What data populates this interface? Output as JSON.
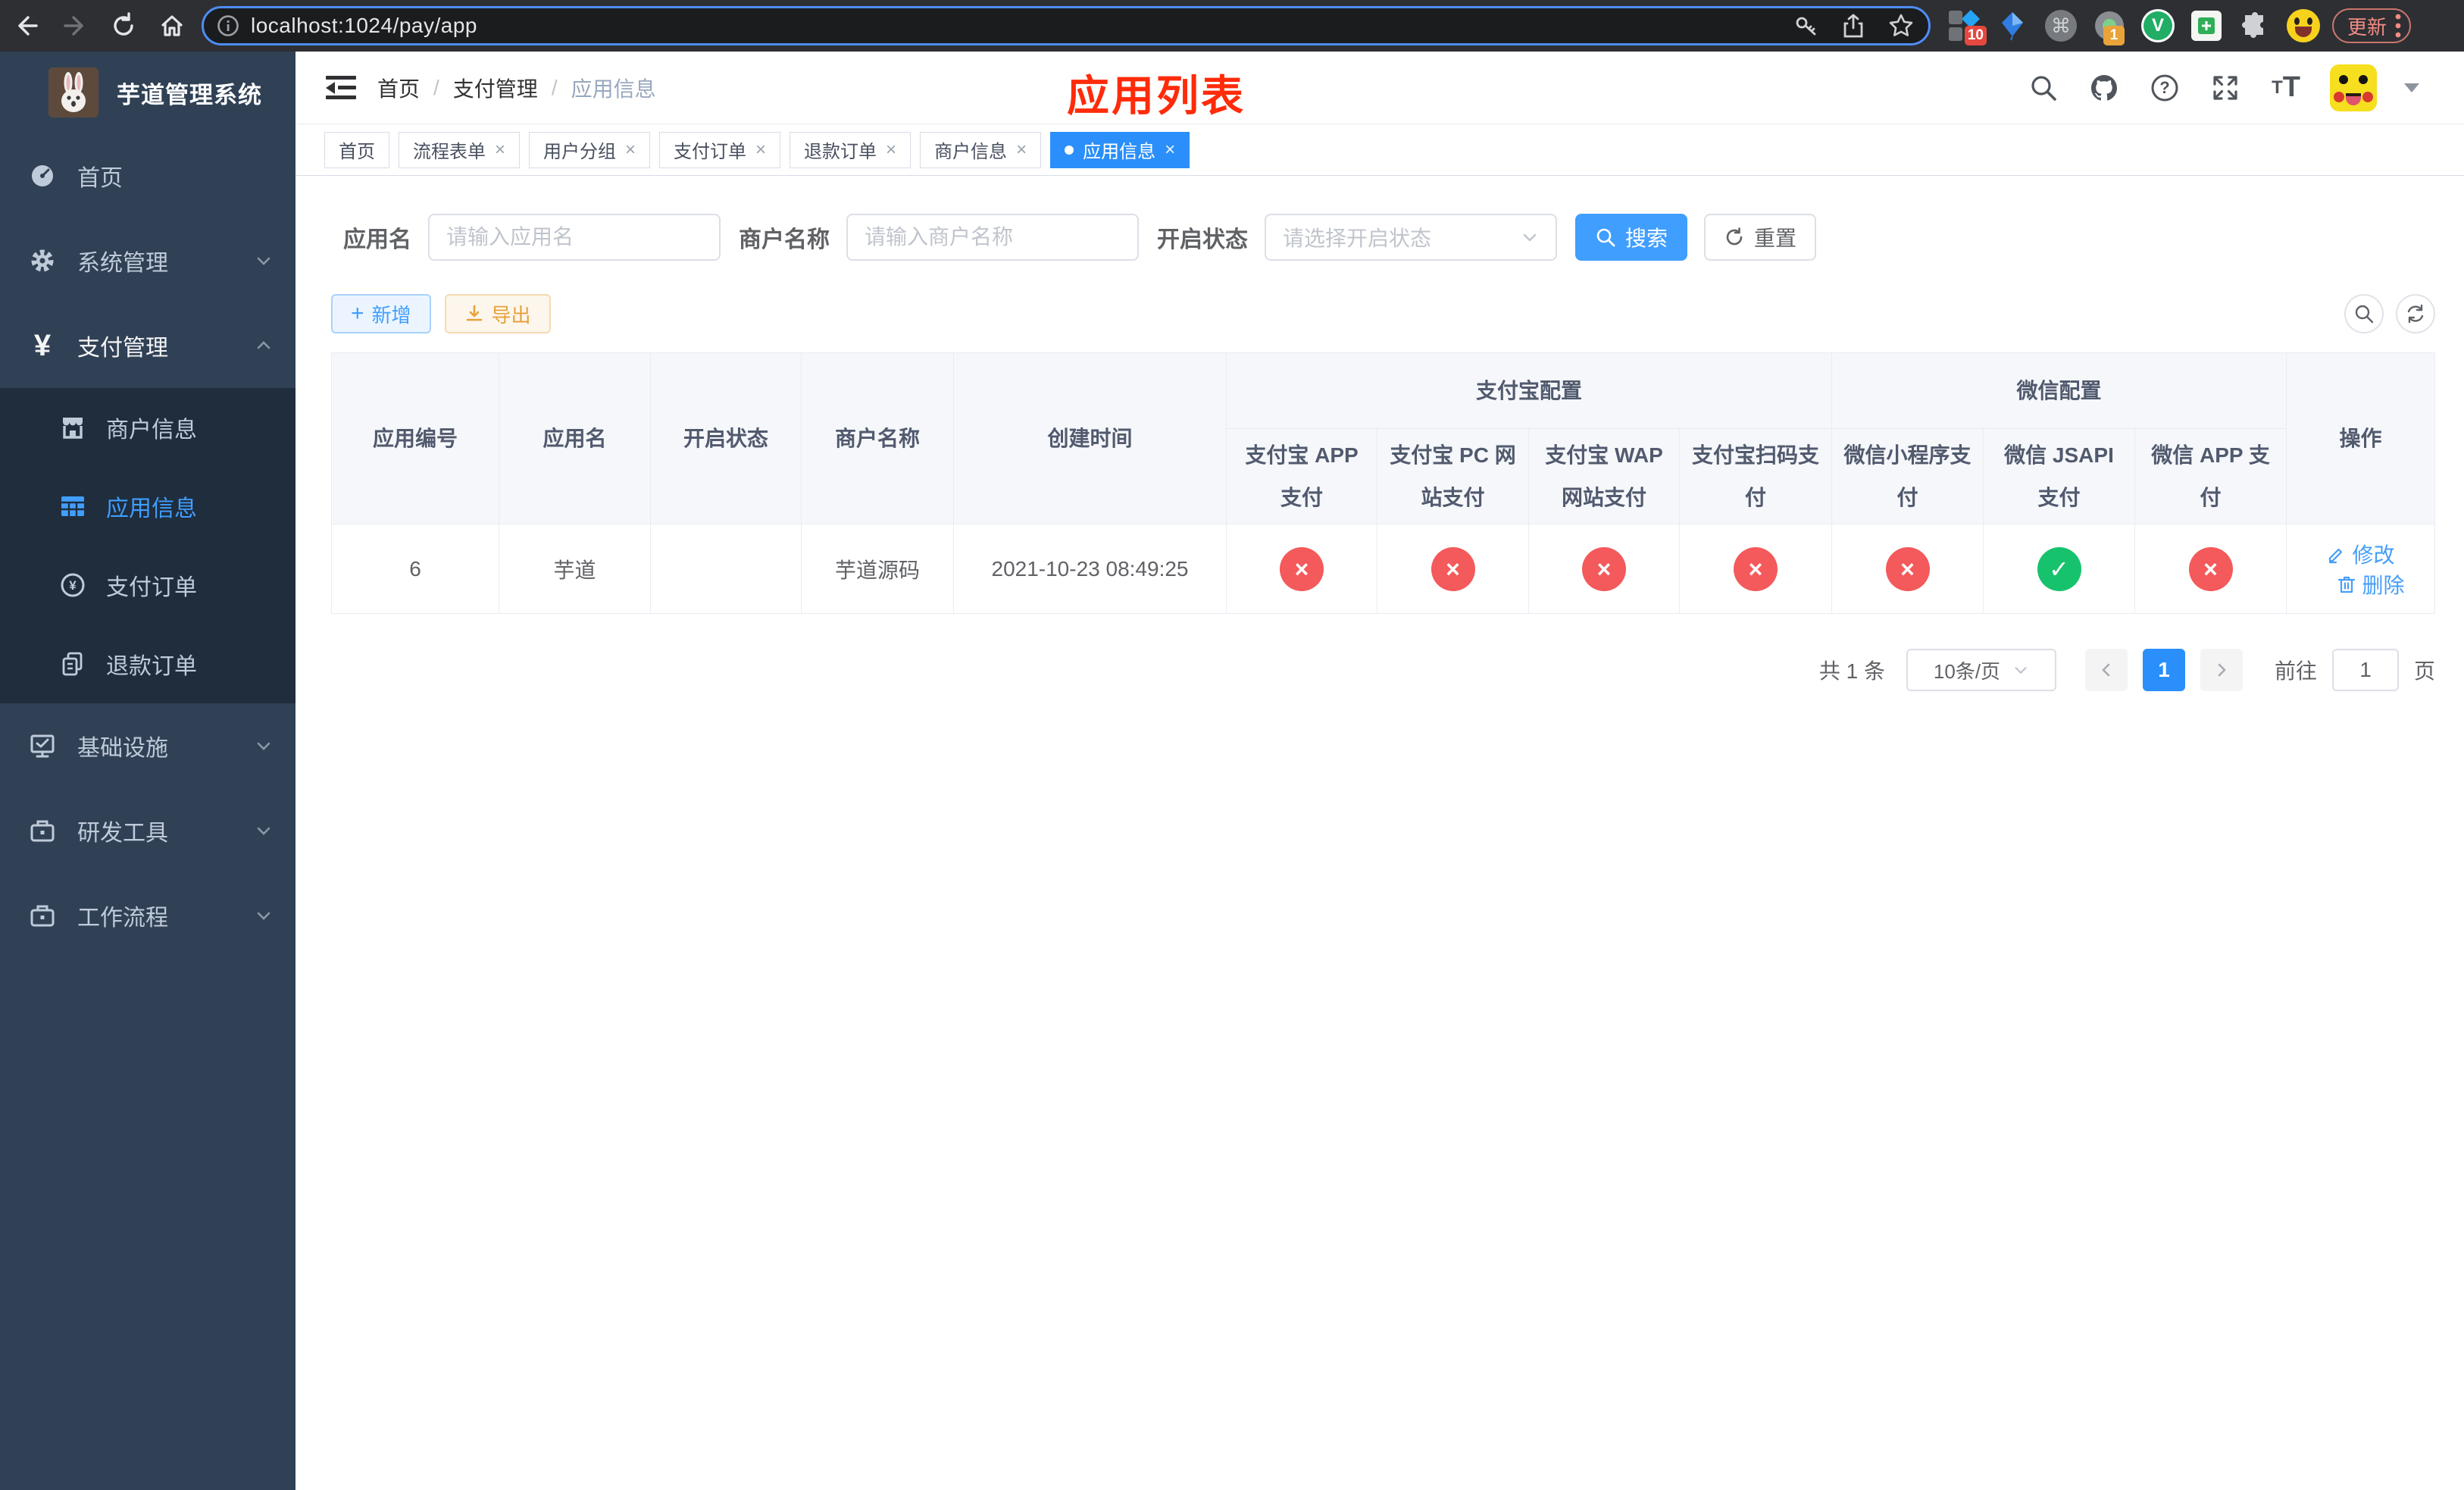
{
  "browser": {
    "url": "localhost:1024/pay/app",
    "update_label": "更新",
    "extension_badges": {
      "pin_badge": "10",
      "profile_badge": "1"
    }
  },
  "sidebar": {
    "logo_title": "芋道管理系统",
    "menu": [
      {
        "label": "首页"
      },
      {
        "label": "系统管理"
      },
      {
        "label": "支付管理"
      },
      {
        "label": "基础设施"
      },
      {
        "label": "研发工具"
      },
      {
        "label": "工作流程"
      }
    ],
    "submenu": [
      {
        "label": "商户信息"
      },
      {
        "label": "应用信息"
      },
      {
        "label": "支付订单"
      },
      {
        "label": "退款订单"
      }
    ]
  },
  "header": {
    "breadcrumb": [
      "首页",
      "支付管理",
      "应用信息"
    ],
    "page_annotation": "应用列表"
  },
  "tabs": [
    {
      "label": "首页"
    },
    {
      "label": "流程表单"
    },
    {
      "label": "用户分组"
    },
    {
      "label": "支付订单"
    },
    {
      "label": "退款订单"
    },
    {
      "label": "商户信息"
    },
    {
      "label": "应用信息"
    }
  ],
  "filters": {
    "app_name_label": "应用名",
    "app_name_placeholder": "请输入应用名",
    "merchant_label": "商户名称",
    "merchant_placeholder": "请输入商户名称",
    "status_label": "开启状态",
    "status_placeholder": "请选择开启状态",
    "search_button": "搜索",
    "reset_button": "重置"
  },
  "toolbar": {
    "add_button": "新增",
    "export_button": "导出"
  },
  "table": {
    "columns": {
      "id": "应用编号",
      "name": "应用名",
      "enabled": "开启状态",
      "merchant": "商户名称",
      "created": "创建时间",
      "alipay_group": "支付宝配置",
      "wechat_group": "微信配置",
      "alipay_app": "支付宝 APP 支付",
      "alipay_pc": "支付宝 PC 网站支付",
      "alipay_wap": "支付宝 WAP 网站支付",
      "alipay_qr": "支付宝扫码支付",
      "wx_lite": "微信小程序支付",
      "wx_jsapi": "微信 JSAPI 支付",
      "wx_app": "微信 APP 支付",
      "actions": "操作"
    },
    "rows": [
      {
        "id": "6",
        "name": "芋道",
        "enabled": true,
        "merchant": "芋道源码",
        "created": "2021-10-23 08:49:25",
        "channels": [
          false,
          false,
          false,
          false,
          false,
          true,
          false
        ],
        "edit_label": "修改",
        "delete_label": "删除"
      }
    ]
  },
  "pagination": {
    "total_text": "共 1 条",
    "page_size": "10条/页",
    "current_page": "1",
    "goto_label": "前往",
    "goto_value": "1",
    "page_unit": "页"
  },
  "colors": {
    "primary": "#409eff",
    "success": "#16c36c",
    "danger": "#f4595b",
    "warning": "#e6a23c",
    "sidebar_bg": "#304156",
    "annotation_red": "#ff2b0a"
  }
}
